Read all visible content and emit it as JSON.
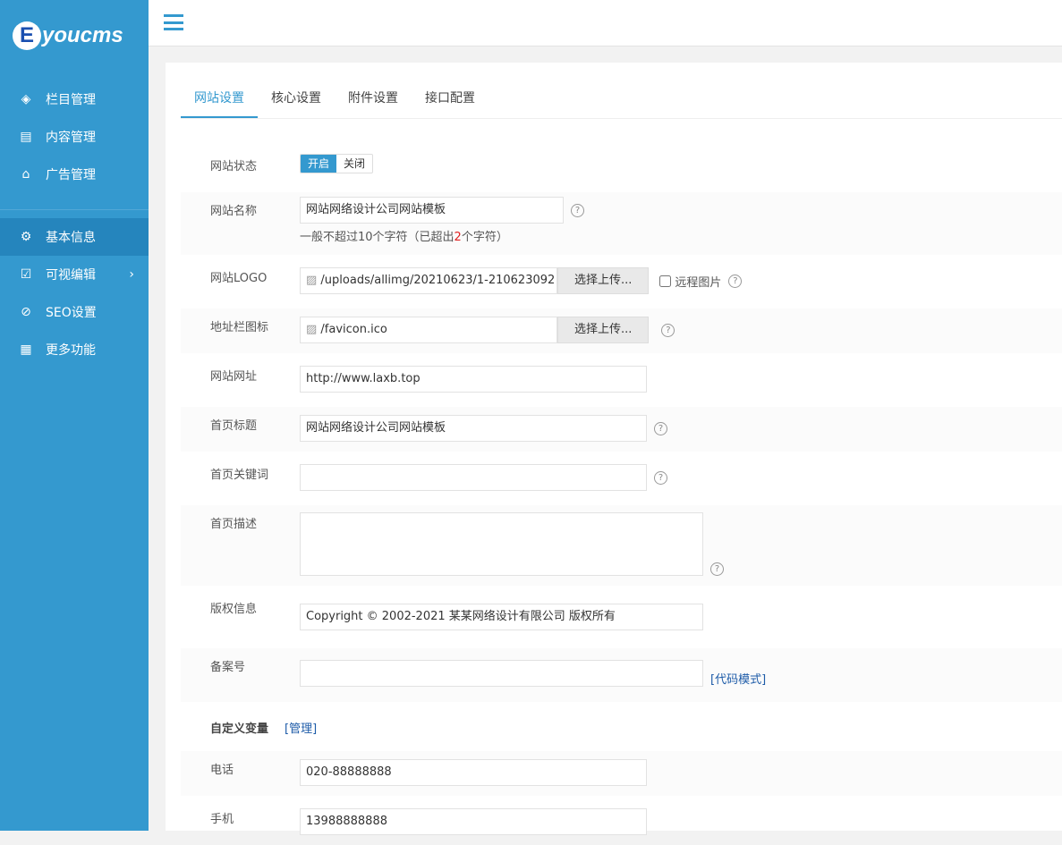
{
  "brand": {
    "logo_letter": "E",
    "logo_text": "youcms"
  },
  "sidebar": {
    "items": [
      {
        "label": "栏目管理",
        "icon": "layers-icon"
      },
      {
        "label": "内容管理",
        "icon": "document-icon"
      },
      {
        "label": "广告管理",
        "icon": "ad-icon"
      },
      {
        "label": "基本信息",
        "icon": "gear-icon",
        "active": true
      },
      {
        "label": "可视编辑",
        "icon": "chart-edit-icon",
        "has_submenu": true
      },
      {
        "label": "SEO设置",
        "icon": "link-icon"
      },
      {
        "label": "更多功能",
        "icon": "grid-icon"
      }
    ]
  },
  "tabs": [
    "网站设置",
    "核心设置",
    "附件设置",
    "接口配置"
  ],
  "form": {
    "status": {
      "label": "网站状态",
      "on": "开启",
      "off": "关闭"
    },
    "name": {
      "label": "网站名称",
      "value": "网站网络设计公司网站模板",
      "note_pre": "一般不超过10个字符（已超出",
      "note_count": "2",
      "note_post": "个字符）"
    },
    "logo": {
      "label": "网站LOGO",
      "value": "/uploads/allimg/20210623/1-210623092",
      "upload": "选择上传...",
      "remote": "远程图片"
    },
    "favicon": {
      "label": "地址栏图标",
      "value": "/favicon.ico",
      "upload": "选择上传..."
    },
    "url": {
      "label": "网站网址",
      "value": "http://www.laxb.top"
    },
    "title": {
      "label": "首页标题",
      "value": "网站网络设计公司网站模板"
    },
    "keywords": {
      "label": "首页关键词",
      "value": ""
    },
    "description": {
      "label": "首页描述",
      "value": ""
    },
    "copyright": {
      "label": "版权信息",
      "value": "Copyright © 2002-2021 某某网络设计有限公司 版权所有"
    },
    "beian": {
      "label": "备案号",
      "value": "",
      "code_mode": "[代码模式]"
    },
    "custom": {
      "label": "自定义变量",
      "manage": "[管理]"
    },
    "phone": {
      "label": "电话",
      "value": "020-88888888"
    },
    "mobile": {
      "label": "手机",
      "value": "13988888888"
    }
  },
  "help_glyph": "?"
}
